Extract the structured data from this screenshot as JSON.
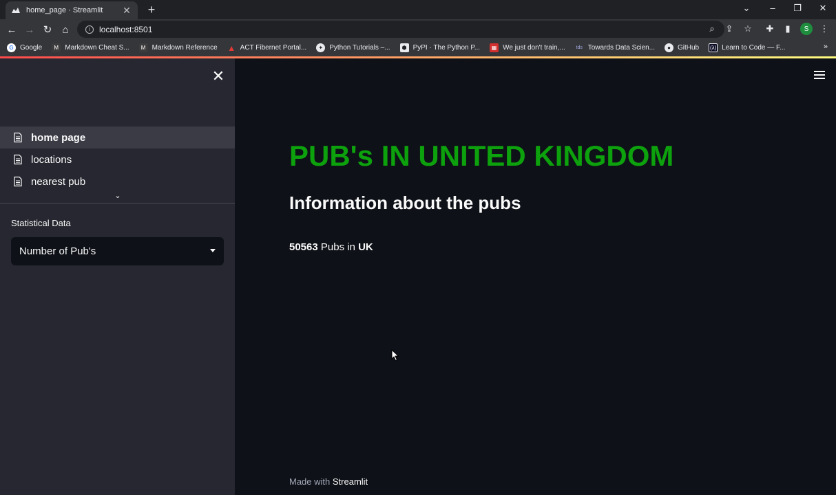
{
  "browser": {
    "tab_title": "home_page · Streamlit",
    "url": "localhost:8501",
    "bookmarks": [
      {
        "label": "Google",
        "icon": "google-icon",
        "color": "#4285f4"
      },
      {
        "label": "Markdown Cheat S...",
        "icon": "markdown-icon",
        "color": "#3c3c3c"
      },
      {
        "label": "Markdown Reference",
        "icon": "markdown-icon",
        "color": "#3c3c3c"
      },
      {
        "label": "ACT Fibernet Portal...",
        "icon": "act-icon",
        "color": "#e53935"
      },
      {
        "label": "Python Tutorials –...",
        "icon": "python-icon",
        "color": "#e8eaed"
      },
      {
        "label": "PyPI · The Python P...",
        "icon": "pypi-icon",
        "color": "#e8eaed"
      },
      {
        "label": "We just don't train,...",
        "icon": "pattern-icon",
        "color": "#d32f2f"
      },
      {
        "label": "Towards Data Scien...",
        "icon": "tds-icon",
        "color": "#5c6bc0"
      },
      {
        "label": "GitHub",
        "icon": "github-icon",
        "color": "#e8eaed"
      },
      {
        "label": "Learn to Code — F...",
        "icon": "freecodecamp-icon",
        "color": "#0a0a23"
      }
    ],
    "avatar_initial": "S"
  },
  "sidebar": {
    "nav": [
      {
        "label": "home page",
        "active": true
      },
      {
        "label": "locations",
        "active": false
      },
      {
        "label": "nearest pub",
        "active": false
      }
    ],
    "select_label": "Statistical Data",
    "select_value": "Number of Pub's"
  },
  "main": {
    "title": "PUB's IN UNITED KINGDOM",
    "subtitle": "Information about the pubs",
    "stat_count": "50563",
    "stat_text": " Pubs in ",
    "stat_country": "UK",
    "footer_prefix": "Made with ",
    "footer_brand": "Streamlit"
  },
  "colors": {
    "accent_green": "#0da10d",
    "sidebar_bg": "#262730",
    "main_bg": "#0e1117"
  }
}
